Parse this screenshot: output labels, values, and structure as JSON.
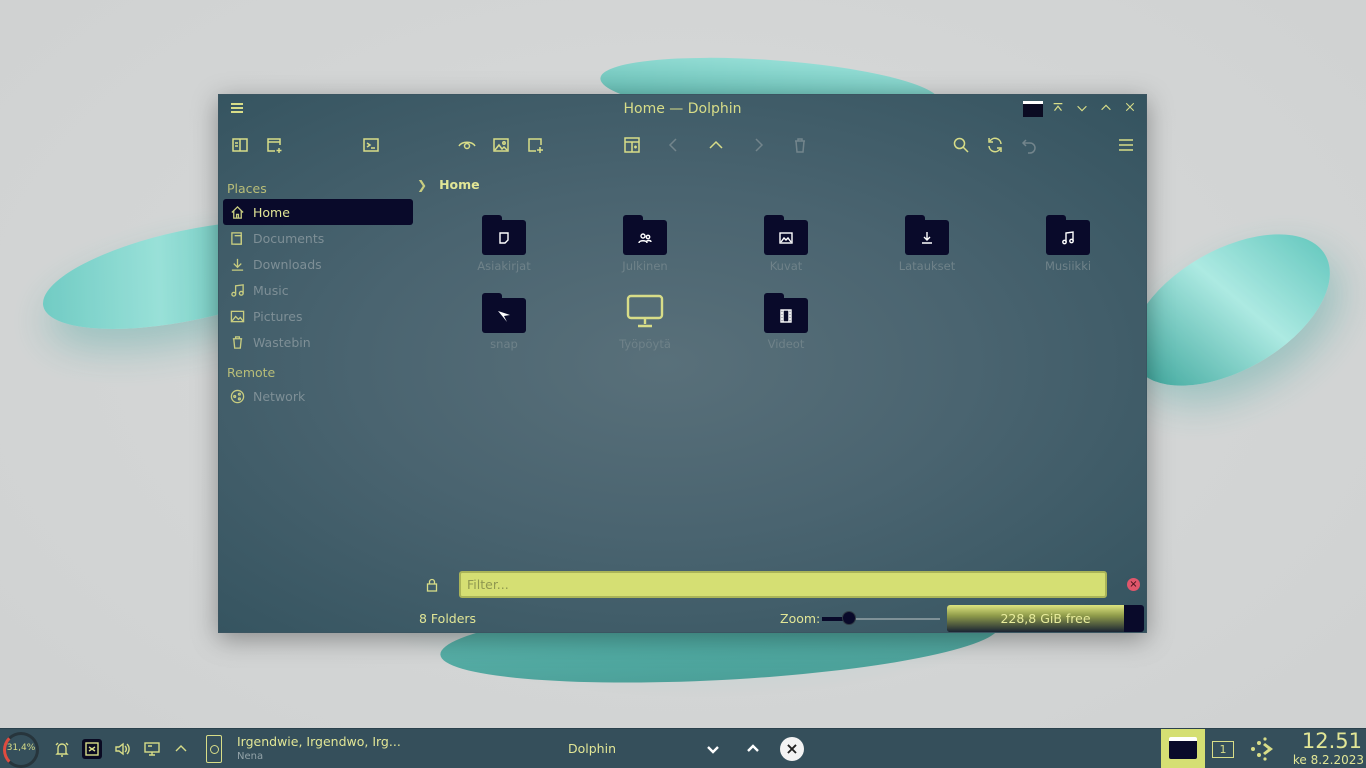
{
  "window": {
    "title": "Home — Dolphin"
  },
  "breadcrumb": {
    "current": "Home"
  },
  "sidebar": {
    "places_header": "Places",
    "remote_header": "Remote",
    "places": [
      {
        "label": "Home",
        "icon": "home-icon",
        "active": true
      },
      {
        "label": "Documents",
        "icon": "documents-icon"
      },
      {
        "label": "Downloads",
        "icon": "downloads-icon"
      },
      {
        "label": "Music",
        "icon": "music-icon"
      },
      {
        "label": "Pictures",
        "icon": "pictures-icon"
      },
      {
        "label": "Wastebin",
        "icon": "wastebin-icon"
      }
    ],
    "remote": [
      {
        "label": "Network",
        "icon": "network-icon"
      }
    ]
  },
  "folders": [
    {
      "name": "Asiakirjat",
      "icon": "document-folder-icon"
    },
    {
      "name": "Julkinen",
      "icon": "public-folder-icon"
    },
    {
      "name": "Kuvat",
      "icon": "pictures-folder-icon"
    },
    {
      "name": "Lataukset",
      "icon": "downloads-folder-icon"
    },
    {
      "name": "Musiikki",
      "icon": "music-folder-icon"
    },
    {
      "name": "snap",
      "icon": "snap-folder-icon"
    },
    {
      "name": "Työpöytä",
      "icon": "desktop-monitor-icon"
    },
    {
      "name": "Videot",
      "icon": "videos-folder-icon"
    }
  ],
  "filter": {
    "placeholder": "Filter...",
    "value": ""
  },
  "status": {
    "folder_count": "8 Folders",
    "zoom_label": "Zoom:",
    "zoom_level": 0.23,
    "free_space": "228,8 GiB free",
    "disk_used_fraction": 0.9
  },
  "taskbar": {
    "cpu_load": "31,4%",
    "media_title": "Irgendwie, Irgendwo, Irg...",
    "media_artist": "Nena",
    "task_name": "Dolphin",
    "virtual_desktop": "1",
    "clock_time": "12.51",
    "clock_date": "ke 8.2.2023"
  },
  "colors": {
    "accent": "#d8dd88",
    "selection": "#090a2a",
    "filter_bg": "#d5df73"
  }
}
